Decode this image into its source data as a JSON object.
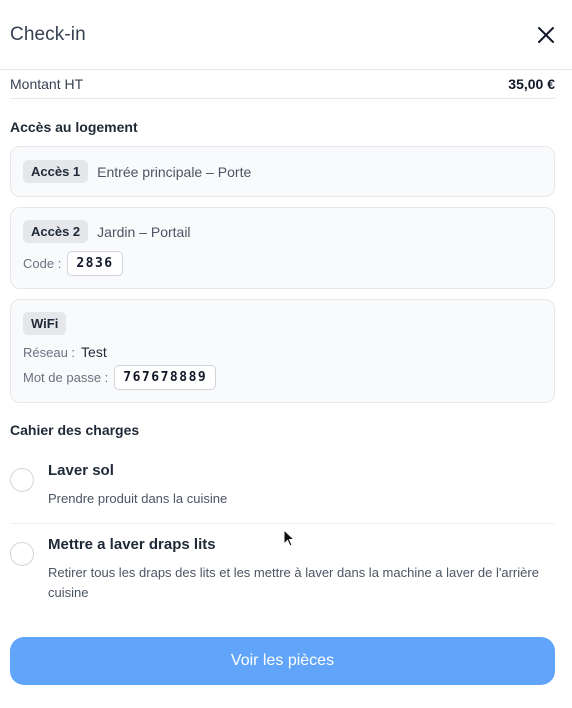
{
  "header": {
    "title": "Check-in"
  },
  "amount": {
    "label": "Montant HT",
    "value": "35,00 €"
  },
  "access_section": {
    "title": "Accès au logement",
    "cards": [
      {
        "chip": "Accès 1",
        "description": "Entrée principale – Porte"
      },
      {
        "chip": "Accès 2",
        "description": "Jardin – Portail",
        "code_label": "Code :",
        "code": "2836"
      },
      {
        "chip": "WiFi",
        "network_label": "Réseau :",
        "network": "Test",
        "password_label": "Mot de passe :",
        "password": "767678889"
      }
    ]
  },
  "charges_section": {
    "title": "Cahier des charges",
    "tasks": [
      {
        "title": "Laver sol",
        "description": "Prendre produit dans la cuisine"
      },
      {
        "title": "Mettre a laver draps lits",
        "description": "Retirer tous les draps des lits et les mettre à laver dans la machine a laver de l'arrière cuisine"
      }
    ]
  },
  "footer": {
    "button_label": "Voir les pièces"
  },
  "colors": {
    "accent": "#60a5fa"
  }
}
